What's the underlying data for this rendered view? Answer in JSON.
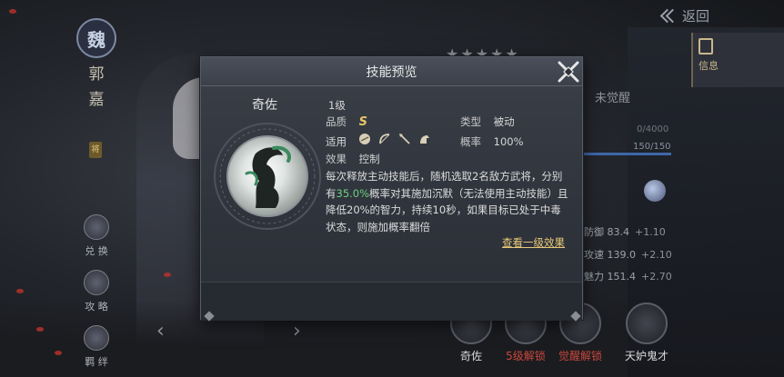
{
  "background": {
    "back_label": "返回",
    "info_tab_label": "信息",
    "stars": "★★★★★",
    "unawakened_label": "未觉醒",
    "exp_top": "0/4000",
    "exp_bottom": "150/150",
    "stats": [
      {
        "label": "防御 83.4",
        "bonus": "+1.10"
      },
      {
        "label": "攻速 139.0",
        "bonus": "+2.10"
      },
      {
        "label": "魅力 151.4",
        "bonus": "+2.70"
      }
    ],
    "faction": "魏",
    "hero_name_chars": [
      "郭",
      "嘉"
    ],
    "rank_chip": "将",
    "rail_buttons": [
      "兑 换",
      "攻 略",
      "羁 绊"
    ],
    "nav_prev": "‹",
    "nav_next": "›",
    "skill_slots": [
      {
        "label": "奇佐",
        "color": "#d9d9d9",
        "badge": "1级"
      },
      {
        "label": "5级解锁",
        "color": "#c8473b",
        "badge": ""
      },
      {
        "label": "觉醒解锁",
        "color": "#c8473b",
        "badge": ""
      },
      {
        "label": "天妒鬼才",
        "color": "#d9d9d9",
        "badge": "未觉醒"
      }
    ]
  },
  "modal": {
    "title": "技能预览",
    "skill_name": "奇佐",
    "level": "1级",
    "quality_label": "品质",
    "quality_value": "S",
    "type_label": "类型",
    "type_value": "被动",
    "applies_label": "适用",
    "applies_icons": [
      "shield-icon",
      "bow-icon",
      "spear-icon",
      "horse-icon"
    ],
    "chance_label": "概率",
    "chance_value": "100%",
    "effect_label": "效果",
    "effect_value": "控制",
    "description_part1": "每次释放主动技能后，随机选取2名敌方武将，分别有",
    "description_highlight": "35.0%",
    "description_part2": "概率对其施加沉默（无法使用主动技能）且降低20%的智力，持续10秒，如果目标已处于中毒状态，则施加概率翻倍",
    "view_level1_link": "查看一级效果"
  },
  "colors": {
    "highlight_green": "#6fd07f",
    "link_gold": "#e9c978",
    "grade_gold": "#e8c56a",
    "locked_red": "#c8473b",
    "exp_blue": "#3f67a8"
  }
}
